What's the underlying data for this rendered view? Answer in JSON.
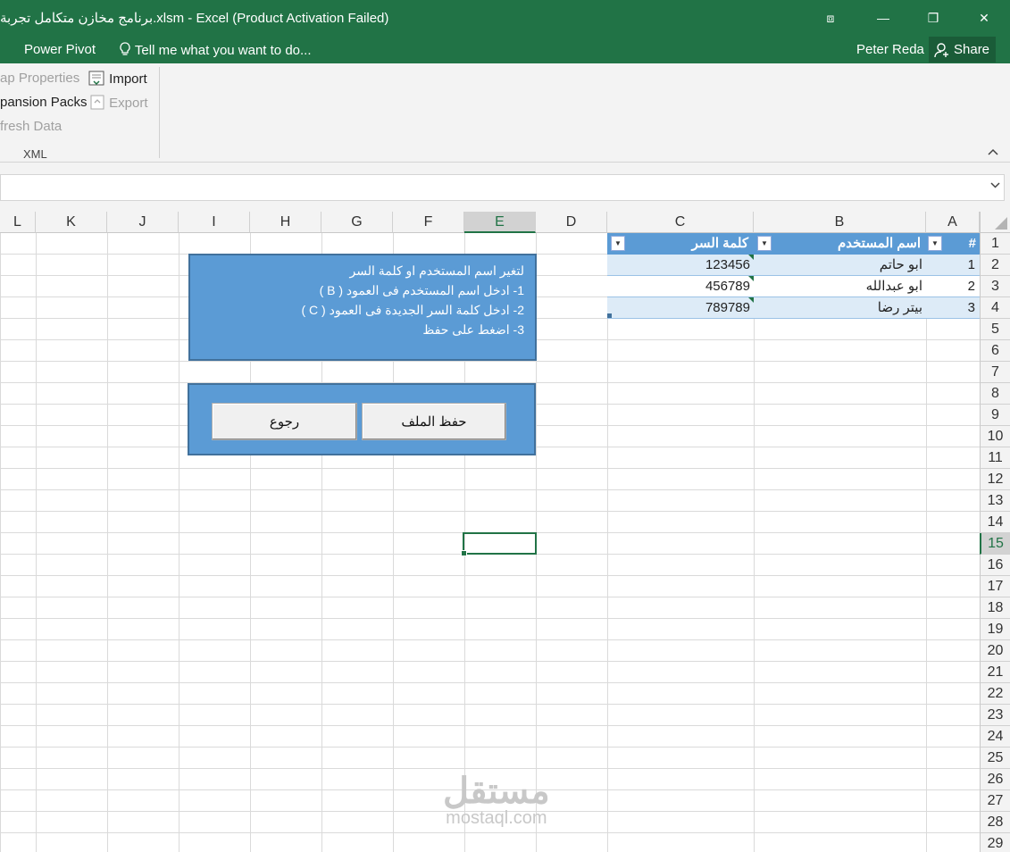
{
  "window": {
    "title": "برنامج مخازن متكامل تجربة.xlsm - Excel (Product Activation Failed)",
    "controls": {
      "ribbon_display": "⧈",
      "minimize": "—",
      "restore": "❐",
      "close": "✕"
    }
  },
  "menubar": {
    "power_pivot": "Power Pivot",
    "tell_me": "Tell me what you want to do...",
    "user": "Peter Reda",
    "share": "Share"
  },
  "ribbon": {
    "map_properties": "ap Properties",
    "expansion_packs": "pansion Packs",
    "refresh_data": "fresh Data",
    "import": "Import",
    "export": "Export",
    "group_label": "XML"
  },
  "sheet": {
    "columns": [
      "L",
      "K",
      "J",
      "I",
      "H",
      "G",
      "F",
      "E",
      "D",
      "C",
      "B",
      "A"
    ],
    "rows": [
      "1",
      "2",
      "3",
      "4",
      "5",
      "6",
      "7",
      "8",
      "9",
      "10",
      "11",
      "12",
      "13",
      "14",
      "15",
      "16",
      "17",
      "18",
      "19",
      "20",
      "21",
      "22",
      "23",
      "24",
      "25",
      "26",
      "27",
      "28",
      "29"
    ],
    "selected_column": "E",
    "selected_row": "15"
  },
  "table": {
    "headers": {
      "a": "#",
      "b": "اسم المستخدم",
      "c": "كلمة السر"
    },
    "rows": [
      {
        "num": "1",
        "user": "ابو حاتم",
        "password": "123456"
      },
      {
        "num": "2",
        "user": "ابو عبدالله",
        "password": "456789"
      },
      {
        "num": "3",
        "user": "بيتر رضا",
        "password": "789789"
      }
    ]
  },
  "instructions": {
    "line1": "لتغير اسم المستخدم او كلمة السر",
    "line2": "1- ادخل اسم المستخدم فى العمود ( B )",
    "line3": "2- ادخل كلمة السر الجديدة فى العمود ( C )",
    "line4": "3- اضغط على حفظ"
  },
  "buttons": {
    "save": "حفظ الملف",
    "back": "رجوع"
  },
  "watermark": {
    "arabic": "مستقل",
    "latin": "mostaql.com"
  }
}
